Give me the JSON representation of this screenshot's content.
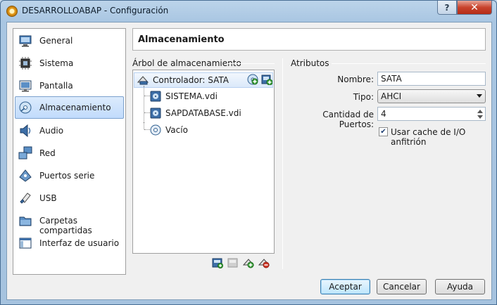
{
  "window": {
    "title": "DESARROLLOABAP - Configuración",
    "help_label": "?",
    "close_label": "✕"
  },
  "sidebar": {
    "items": [
      {
        "label": "General",
        "icon": "monitor-icon",
        "selected": false
      },
      {
        "label": "Sistema",
        "icon": "chip-icon",
        "selected": false
      },
      {
        "label": "Pantalla",
        "icon": "display-icon",
        "selected": false
      },
      {
        "label": "Almacenamiento",
        "icon": "storage-icon",
        "selected": true
      },
      {
        "label": "Audio",
        "icon": "speaker-icon",
        "selected": false
      },
      {
        "label": "Red",
        "icon": "network-icon",
        "selected": false
      },
      {
        "label": "Puertos serie",
        "icon": "serial-port-icon",
        "selected": false
      },
      {
        "label": "USB",
        "icon": "usb-icon",
        "selected": false
      },
      {
        "label": "Carpetas compartidas",
        "icon": "folder-icon",
        "selected": false
      },
      {
        "label": "Interfaz de usuario",
        "icon": "window-icon",
        "selected": false
      }
    ]
  },
  "page": {
    "title": "Almacenamiento",
    "tree_group_title": "Árbol de almacenamiento",
    "attr_group_title": "Atributos"
  },
  "tree": {
    "controller": "Controlador: SATA",
    "children": [
      {
        "label": "SISTEMA.vdi",
        "icon": "hard-disk-icon"
      },
      {
        "label": "SAPDATABASE.vdi",
        "icon": "hard-disk-icon"
      },
      {
        "label": "Vacío",
        "icon": "optical-disc-icon"
      }
    ]
  },
  "attributes": {
    "name_label": "Nombre:",
    "name_value": "SATA",
    "type_label": "Tipo:",
    "type_value": "AHCI",
    "ports_label": "Cantidad de Puertos:",
    "ports_value": "4",
    "cache_label": "Usar cache de I/O anfitrión",
    "cache_checked": true
  },
  "buttons": {
    "accept": "Aceptar",
    "cancel": "Cancelar",
    "help": "Ayuda"
  },
  "colors": {
    "selection": "#c1dbfc",
    "accent": "#3c7fb1",
    "close": "#c8432d"
  }
}
